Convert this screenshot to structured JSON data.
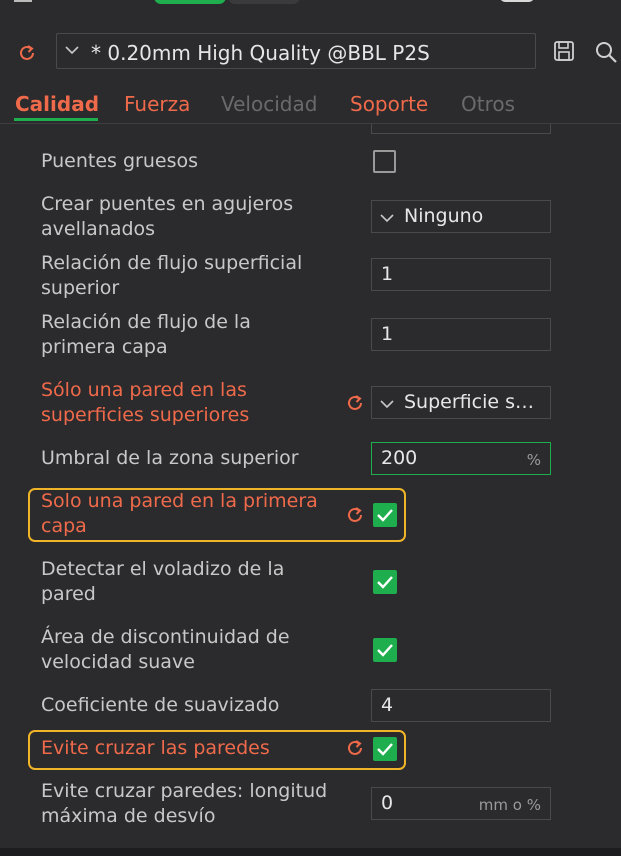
{
  "header": {
    "preset_name": "* 0.20mm High Quality @BBL P2S"
  },
  "tabs": [
    {
      "label": "Calidad",
      "state": "active"
    },
    {
      "label": "Fuerza",
      "state": "modified"
    },
    {
      "label": "Velocidad",
      "state": "normal"
    },
    {
      "label": "Soporte",
      "state": "modified"
    },
    {
      "label": "Otros",
      "state": "normal"
    }
  ],
  "settings": {
    "thick_bridges": {
      "label": "Puentes gruesos",
      "checked": false
    },
    "countersunk_bridges": {
      "label_line1": "Crear puentes en agujeros",
      "label_line2": "avellanados",
      "value": "Ninguno"
    },
    "top_flow_ratio": {
      "label_line1": "Relación de flujo superficial",
      "label_line2": "superior",
      "value": "1"
    },
    "first_layer_flow_ratio": {
      "label_line1": "Relación de flujo de la",
      "label_line2": "primera capa",
      "value": "1"
    },
    "single_wall_top": {
      "label_line1": "Sólo una pared en las",
      "label_line2": "superficies superiores",
      "value": "Superficie s…",
      "modified": true
    },
    "top_area_threshold": {
      "label": "Umbral de la zona superior",
      "value": "200",
      "unit": "%"
    },
    "single_wall_first_layer": {
      "label_line1": "Solo una pared en la primera",
      "label_line2": "capa",
      "checked": true,
      "modified": true
    },
    "detect_overhang_wall": {
      "label_line1": "Detectar el voladizo de la",
      "label_line2": "pared",
      "checked": true
    },
    "smooth_speed_discontinuity": {
      "label_line1": "Área de discontinuidad de",
      "label_line2": "velocidad suave",
      "checked": true
    },
    "smoothing_coefficient": {
      "label": "Coeficiente de suavizado",
      "value": "4"
    },
    "avoid_crossing_walls": {
      "label": "Evite cruzar las paredes",
      "checked": true,
      "modified": true
    },
    "avoid_crossing_max_detour": {
      "label_line1": "Evite cruzar paredes: longitud",
      "label_line2": "máxima de desvío",
      "value": "0",
      "unit": "mm o %"
    }
  },
  "colors": {
    "accent_green": "#1fae4e",
    "modified_orange": "#ef6a4a",
    "highlight_yellow": "#f0b429",
    "background": "#2b2b2d"
  }
}
